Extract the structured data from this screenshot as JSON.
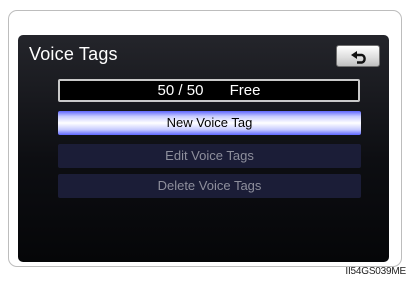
{
  "header": {
    "title": "Voice Tags",
    "back_icon": "back-arrow-icon"
  },
  "counter": {
    "used": "50",
    "separator": "/",
    "total": "50",
    "status": "Free"
  },
  "menu": {
    "items": [
      {
        "label": "New Voice Tag",
        "state": "active"
      },
      {
        "label": "Edit Voice Tags",
        "state": "disabled"
      },
      {
        "label": "Delete Voice Tags",
        "state": "disabled"
      }
    ]
  },
  "caption": "II54GS039ME",
  "colors": {
    "accent_blue": "#5e66ff",
    "screen_bg": "#0d0e12",
    "disabled_btn": "#1b1d37"
  }
}
